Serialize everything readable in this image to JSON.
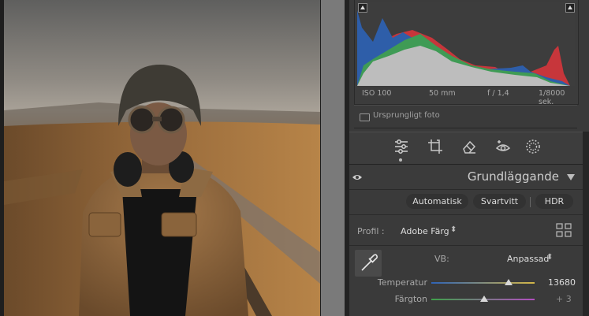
{
  "histogram": {
    "exif": {
      "iso": "ISO 100",
      "focal": "50 mm",
      "aperture": "f / 1,4",
      "shutter": "1/8000 sek."
    },
    "original_label": "Ursprungligt foto"
  },
  "tools": [
    "edit-sliders-icon",
    "crop-icon",
    "eraser-icon",
    "redeye-icon",
    "masking-icon"
  ],
  "basic": {
    "title": "Grundläggande",
    "buttons": {
      "auto": "Automatisk",
      "bw": "Svartvitt",
      "hdr": "HDR"
    },
    "profile_label": "Profil :",
    "profile_value": "Adobe Färg",
    "wb_label": "VB:",
    "wb_value": "Anpassad",
    "sliders": [
      {
        "label": "Temperatur",
        "value": "13680",
        "position": 0.75
      },
      {
        "label": "Färgton",
        "value": "+ 3",
        "position": 0.51
      }
    ]
  },
  "colors": {
    "panel_bg": "#3a3a3a",
    "accent_text": "#dedede"
  }
}
